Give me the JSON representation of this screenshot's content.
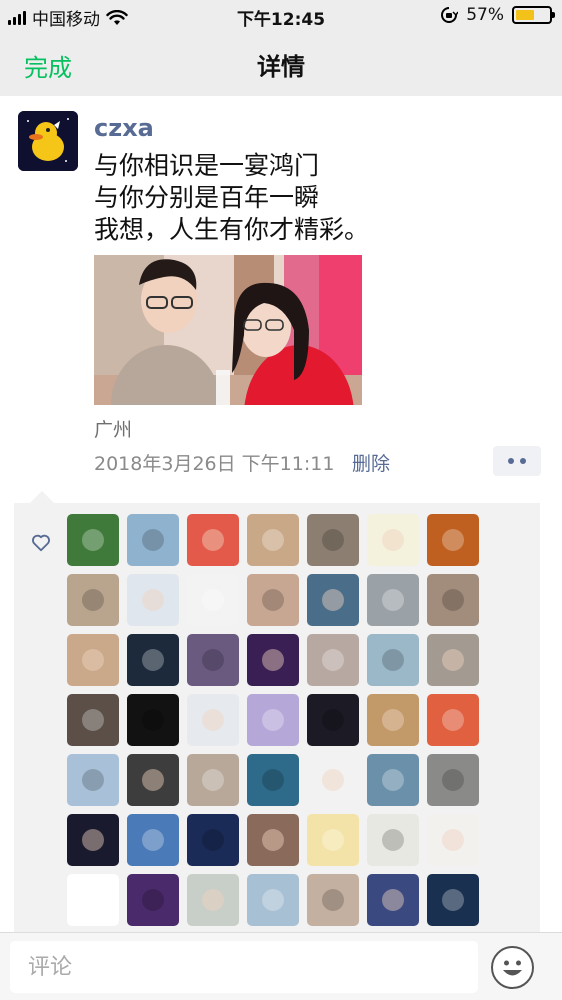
{
  "status_bar": {
    "carrier": "中国移动",
    "time": "下午12:45",
    "battery": "57%",
    "battery_level": 0.57
  },
  "nav": {
    "done_label": "完成",
    "title": "详情"
  },
  "post": {
    "username": "czxa",
    "text_lines": [
      "与你相识是一宴鸿门",
      "与你分别是百年一瞬",
      "我想，人生有你才精彩。"
    ],
    "location": "广州",
    "time": "2018年3月26日 下午11:11",
    "delete_label": "删除"
  },
  "likes": {
    "avatar_colors": [
      "#3f7a3a",
      "#8fb3cf",
      "#e35a4b",
      "#c9a888",
      "#8c7e70",
      "#f4f1dc",
      "#c06020",
      "#b9a48e",
      "#dfe6ee",
      "#f3f3f3",
      "#c7a792",
      "#4a6d8a",
      "#9aa2a8",
      "#a28c7c",
      "#c9a98a",
      "#1c2a3c",
      "#6a5a80",
      "#3a1f55",
      "#b8a8a2",
      "#9bb8c8",
      "#a39a92",
      "#5b4f48",
      "#121212",
      "#e6eaee",
      "#b5a8d8",
      "#1c1a24",
      "#c29a6a",
      "#e06040",
      "#a8c0d8",
      "#3d3d3d",
      "#b8a89a",
      "#2e6b8a",
      "#f2f2f2",
      "#6a90aa",
      "#8a8a88",
      "#1a1a2e",
      "#4a7ab8",
      "#1b2b58",
      "#8a6a5a",
      "#f4e3a8",
      "#e8e8e2",
      "#f3f1ee",
      "#ffffff",
      "#4a2a6a",
      "#c8cec8",
      "#a8c0d4",
      "#c4b0a0",
      "#3a4a80",
      "#1a3050"
    ]
  },
  "comment": {
    "placeholder": "评论"
  },
  "icons": {
    "emoji": "smiley-face-icon",
    "like": "heart-outline-icon",
    "more": "ellipsis-icon"
  }
}
